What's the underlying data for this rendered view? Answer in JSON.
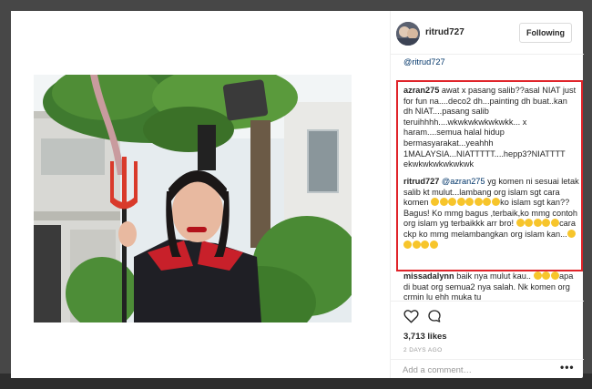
{
  "post": {
    "username": "ritrud727",
    "follow_label": "Following",
    "photo_description_icon": "photo-girl-devil-costume"
  },
  "comments": {
    "truncated_top": "@ritrud727",
    "items": [
      {
        "user": "azran275",
        "text": "awat x pasang salib??asal NIAT just for fun na....deco2 dh...painting dh buat..kan dh NIAT....pasang salib teruihhhh....wkwkwkwkwkwkk... x haram....semua halal hidup bermasyarakat...yeahhh 1MALAYSIA...NIATTTTT....hepp3?NIATTTT ekwkwkwkwkwkwk"
      },
      {
        "user": "ritrud727",
        "mention": "@azran275",
        "text_a": " yg komen ni sesuai letak salib kt mulut...lambang org islam sgt cara komen ",
        "text_b": "ko islam sgt kan?? Bagus! Ko mmg bagus ,terbaik,ko mmg contoh org islam yg terbaikkk arr bro! ",
        "text_c": "cara ckp ko mmg melambangkan org islam kan..."
      },
      {
        "user": "missadalynn",
        "text_a": " baik nya mulut kau.. ",
        "text_b": "apa di buat org semua2 nya salah. Nk komen org crmin lu ehh muka tu"
      }
    ]
  },
  "actions": {
    "likes": "3,713 likes",
    "time": "2 DAYS AGO",
    "add_comment_placeholder": "Add a comment…",
    "more_label": "•••"
  },
  "colors": {
    "highlight_border": "#e0242a",
    "mention": "#003569"
  }
}
